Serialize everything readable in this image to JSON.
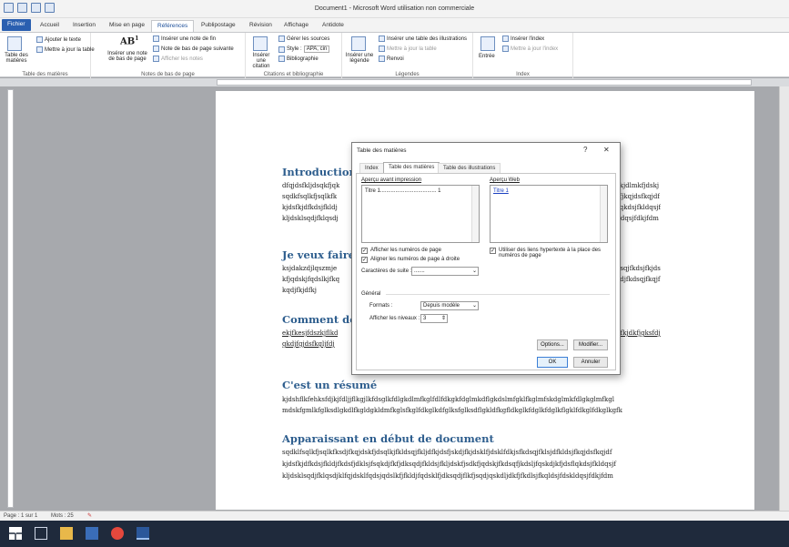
{
  "window": {
    "title": "Document1 - Microsoft Word utilisation non commerciale"
  },
  "tabs": [
    "Fichier",
    "Accueil",
    "Insertion",
    "Mise en page",
    "Références",
    "Publipostage",
    "Révision",
    "Affichage",
    "Antidote"
  ],
  "ribbon": {
    "toc_group": {
      "big": "Table des matières",
      "add_text": "Ajouter le texte",
      "update": "Mettre à jour la table",
      "label": "Table des matières"
    },
    "footnotes_group": {
      "insert_footnote_big": "Insérer une note de bas de page",
      "insert_endnote": "Insérer une note de fin",
      "next_footnote": "Note de bas de page suivante",
      "show_notes": "Afficher les notes",
      "label": "Notes de bas de page"
    },
    "citations_group": {
      "insert_citation": "Insérer une citation",
      "manage_sources": "Gérer les sources",
      "style_label": "Style :",
      "style_value": "APA, cin",
      "bibliography": "Bibliographie",
      "label": "Citations et bibliographie"
    },
    "captions_group": {
      "insert_caption": "Insérer une légende",
      "insert_tof": "Insérer une table des illustrations",
      "update_table": "Mettre à jour la table",
      "cross_ref": "Renvoi",
      "label": "Légendes"
    },
    "index_group": {
      "mark_entry": "Entrée",
      "insert_index": "Insérer l'index",
      "update_index": "Mettre à jour l'index",
      "label": "Index"
    }
  },
  "document": {
    "h1": "Introduction",
    "p1": [
      "dfqjdsfkljdsqkfjqk",
      "sqdkfsqlkfjsqlkfk",
      "kjdsfkjdfkdsjfkldj",
      "kljdsklsqdjfklqsdj"
    ],
    "p1r": [
      "flkjdsfkjdlmkfjdskj",
      "dfkldsfjkqjdsfkqjdf",
      "kfjdsflqkdsjfkldqsjf",
      "sjfdskldqsjfdkjfdm"
    ],
    "h2": "Je veux faire",
    "p2": [
      "ksjdakzdjlqszmje",
      "kfjqdskjfqdslkjfkq",
      "kqdjfkjdfkj"
    ],
    "p2r": [
      "qdjfkdsqjfkdsjfkjds",
      "qkfjqkdjfkdsqjfkqjf"
    ],
    "h3": "Comment doi",
    "p3": [
      "ekjfkesjfdszkjflkd",
      "gkdjfgjdsfkgljfdj"
    ],
    "p3r": [
      "ldjfgjgfkjdkfjgksfdj"
    ],
    "h4": "C'est un résumé",
    "p4": [
      "kjdshflkfehksfdjkjfdljjflkgjlkfdsglkfdlgkdlmfkglfdlfdkgkfdglmkdflgkdslmfgklfkglmfskdglmkfdlgkglmfkgl",
      "mdskfgmlkfglksdlgkdlfkgldgkldmfkglsfkglfdkglkdfglksfglksdflgkldfkgfldkglkfdglkfdglkflgklfdkglfdkglkgfk"
    ],
    "h5": "Apparaissant en début de document",
    "p5": [
      "sqdklfsqlkfjsqlkfksdjfkqjdskfjdsqlkjfkldsqjfkljdfkjdsfjskdjfkjdsklfjdsklfdkjsfkdsqjfklsjdfkldsjfkqjdsfkqjdf",
      "kjdsfkjdfkdsjfkldjfkdsfjdklsjfsqkdjfkfjdksqdjfkldsjfkljdskfjsdkfjqdskjfkdsqfjkdsljfqskdjkfjdsflqkdsjfkldqsjf",
      "kljdsklsqdjfklqsdjklfqjdsklfqdsjqdslkfjfkldjfqdsklfjdksqdjflkfjsqdjqskdljdkfjfkdlsjfkqldsjfdskldqsjfdkjfdm"
    ]
  },
  "dialog": {
    "title": "Table des matières",
    "help": "?",
    "close": "✕",
    "tabs": [
      "Index",
      "Table des matières",
      "Table des illustrations"
    ],
    "print_preview_label": "Aperçu avant impression",
    "print_preview_entry": "Titre 1..................................... 1",
    "web_preview_label": "Aperçu Web",
    "web_preview_entry": "Titre 1",
    "show_page_numbers": "Afficher les numéros de page",
    "align_right": "Aligner les numéros de page à droite",
    "use_hyperlinks": "Utiliser des liens hypertexte à la place des numéros de page",
    "leader_label": "Caractères de suite :",
    "leader_value": ".......",
    "general_label": "Général",
    "formats_label": "Formats :",
    "formats_value": "Depuis modèle",
    "levels_label": "Afficher les niveaux :",
    "levels_value": "3",
    "options_btn": "Options...",
    "modify_btn": "Modifier...",
    "ok_btn": "OK",
    "cancel_btn": "Annuler"
  },
  "status": {
    "page": "Page : 1 sur 1",
    "words": "Mots : 25"
  },
  "colors": {
    "accent": "#2a5fb0",
    "heading": "#2e5e8e"
  }
}
